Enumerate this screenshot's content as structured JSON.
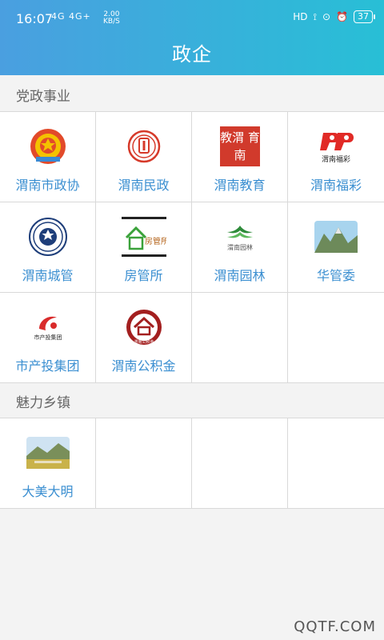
{
  "status_bar": {
    "time": "16:07",
    "signal": "4G 4G+",
    "speed": "2.00",
    "speed_unit": "KB/S",
    "hd": "HD",
    "battery": "37"
  },
  "header": {
    "title": "政企"
  },
  "sections": [
    {
      "title": "党政事业",
      "items": [
        {
          "label": "渭南市政协",
          "icon": "cppcc-emblem-icon"
        },
        {
          "label": "渭南民政",
          "icon": "civil-affairs-logo-icon"
        },
        {
          "label": "渭南教育",
          "icon": "education-seal-icon",
          "logo_text": "教渭 育南"
        },
        {
          "label": "渭南福彩",
          "icon": "welfare-lottery-logo-icon",
          "logo_text": "渭南福彩"
        },
        {
          "label": "渭南城管",
          "icon": "urban-management-badge-icon"
        },
        {
          "label": "房管所",
          "icon": "housing-management-logo-icon",
          "logo_text": "房管所"
        },
        {
          "label": "渭南园林",
          "icon": "garden-logo-icon",
          "logo_text": "渭南园林"
        },
        {
          "label": "华管委",
          "icon": "mountain-photo-icon"
        },
        {
          "label": "市产投集团",
          "icon": "investment-group-logo-icon",
          "logo_text": "市产投集团"
        },
        {
          "label": "渭南公积金",
          "icon": "housing-fund-logo-icon",
          "logo_text": "渭南公积金"
        }
      ]
    },
    {
      "title": "魅力乡镇",
      "items": [
        {
          "label": "大美大明",
          "icon": "landscape-photo-icon"
        }
      ]
    }
  ],
  "watermark": "QQTF.COM",
  "colors": {
    "header_start": "#4a9fe0",
    "header_end": "#28bfd6",
    "label": "#3b8fd1",
    "background": "#f3f3f3"
  }
}
